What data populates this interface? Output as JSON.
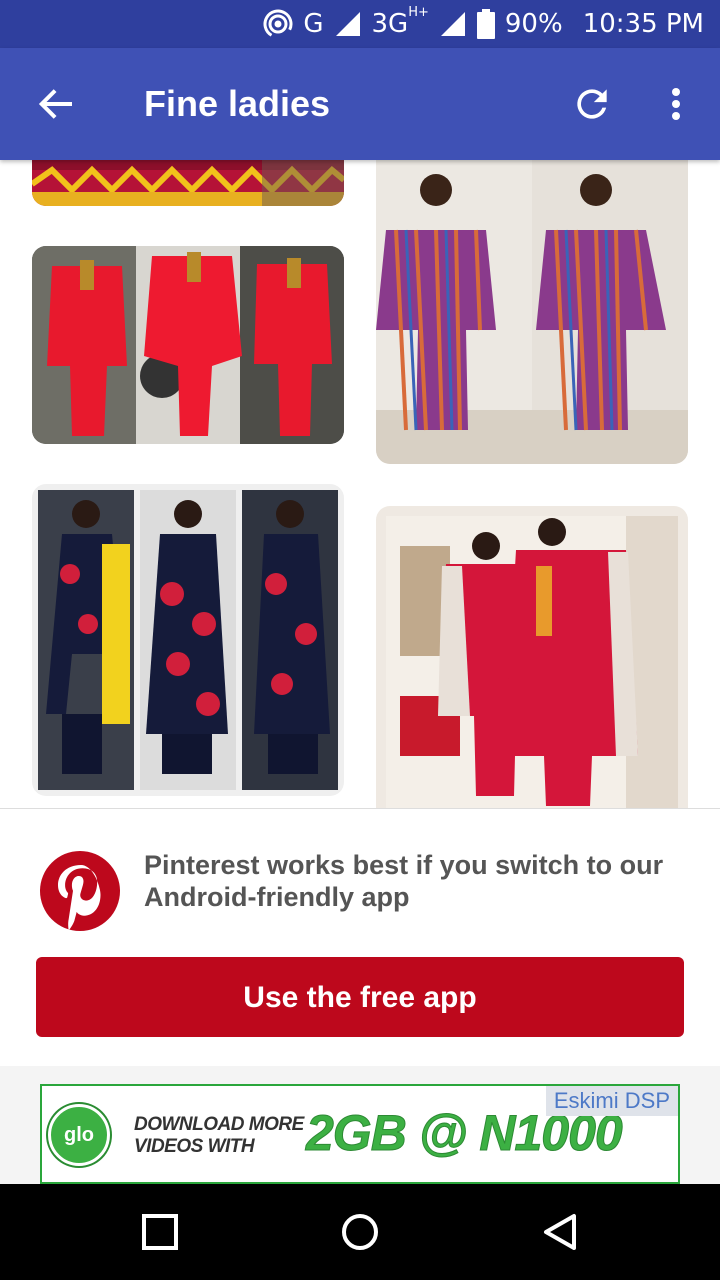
{
  "status_bar": {
    "network_g": "G",
    "network_3g": "3G",
    "network_hplus": "H+",
    "battery": "90%",
    "time": "10:35 PM"
  },
  "app_bar": {
    "title": "Fine ladies",
    "icons": [
      "back-arrow-icon",
      "refresh-icon",
      "more-vert-icon"
    ]
  },
  "feed": {
    "pins": [
      {
        "id": "pin-1",
        "colors": [
          "#c2123a",
          "#f2c21b",
          "#1b1b1b"
        ]
      },
      {
        "id": "pin-2",
        "colors": [
          "#e3192d",
          "#ffffff",
          "#3d3d3d"
        ]
      },
      {
        "id": "pin-3",
        "colors": [
          "#8a3a8c",
          "#d86b3a",
          "#e8e3dd"
        ]
      },
      {
        "id": "pin-4",
        "colors": [
          "#151b3a",
          "#d11f3b",
          "#f2d21e"
        ]
      },
      {
        "id": "pin-5",
        "colors": [
          "#d4163a",
          "#efe9e2",
          "#c0a98c"
        ]
      }
    ]
  },
  "banner": {
    "message": "Pinterest works best if you switch to our Android-friendly app",
    "button": "Use the free app",
    "brand_color": "#bd081c"
  },
  "ad": {
    "brand": "glo",
    "line1": "DOWNLOAD MORE",
    "line2": "VIDEOS WITH",
    "offer": "2GB @ N1000",
    "tag": "Eskimi DSP"
  },
  "nav_bar": {
    "icons": [
      "recents-square-icon",
      "home-circle-icon",
      "back-triangle-icon"
    ]
  },
  "colors": {
    "status_bar": "#2f3f9e",
    "app_bar": "#3f51b5"
  }
}
